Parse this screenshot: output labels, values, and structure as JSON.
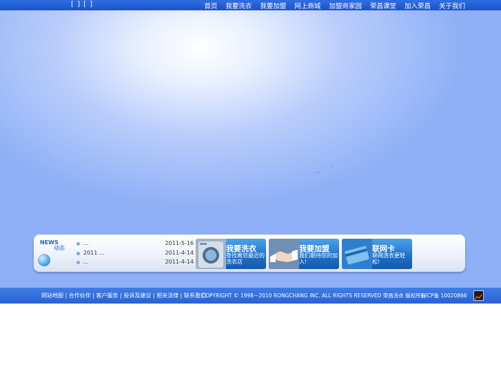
{
  "top": {
    "lang": "[ ] [ ]",
    "nav": [
      "首页",
      "我要洗衣",
      "我要加盟",
      "网上商城",
      "加盟商家园",
      "荣昌课堂",
      "加入荣昌",
      "关于我们"
    ]
  },
  "news": {
    "label_en": "NEWS",
    "label_cn": "动态",
    "items": [
      {
        "title": "...",
        "date": "2011-5-16"
      },
      {
        "title": "2011      ...",
        "date": "2011-4-14"
      },
      {
        "title": "...",
        "date": "2011-4-14"
      }
    ]
  },
  "cards": [
    {
      "title": "我要洗衣",
      "sub": "查找离您最近的洗衣店"
    },
    {
      "title": "我要加盟",
      "sub": "我们期待您的加入!"
    },
    {
      "title": "联网卡",
      "sub": "联网洗衣更轻松!"
    }
  ],
  "footer": {
    "links": "网站地图 | 合作伙伴 | 客户服务 | 投诉及建议 | 相关法律 | 联系我们",
    "copyright": "COPYRIGHT © 1998－2010 RONGCHANG INC. ALL RIGHTS RESERVED 荣昌洗衣 版权所有",
    "icp": "京ICP备 10020866"
  },
  "colors": {
    "bar": "#2a62d4",
    "card": "#1d6fc8",
    "accent": "#2a60c8"
  }
}
